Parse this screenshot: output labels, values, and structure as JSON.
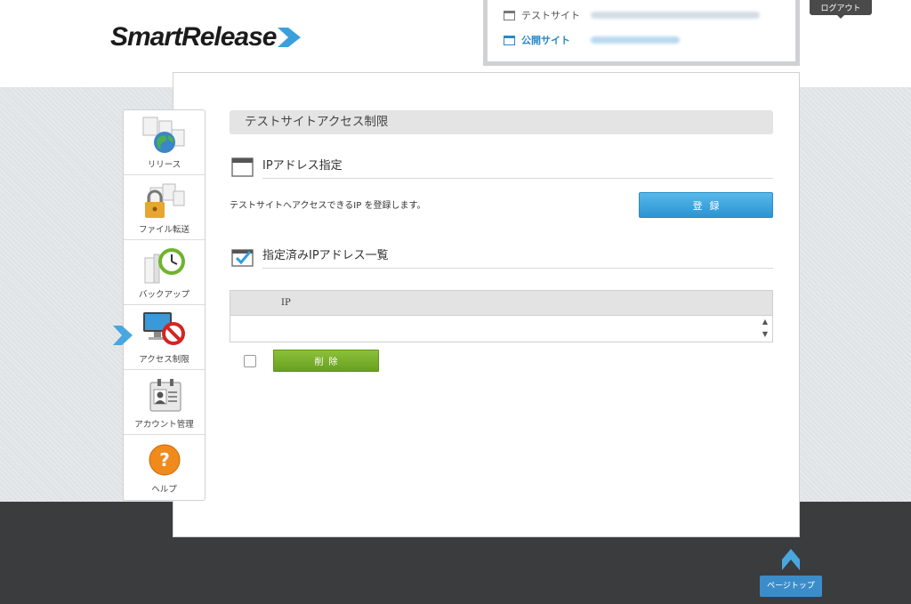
{
  "brand": {
    "name": "SmartRelease"
  },
  "header": {
    "logout_label": "ログアウト",
    "sites": [
      {
        "label": "テストサイト",
        "url": ""
      },
      {
        "label": "公開サイト",
        "url": ""
      }
    ]
  },
  "sidebar": {
    "items": [
      {
        "label": "リリース",
        "icon": "release-globe-icon"
      },
      {
        "label": "ファイル転送",
        "icon": "file-lock-icon"
      },
      {
        "label": "バックアップ",
        "icon": "backup-clock-icon"
      },
      {
        "label": "アクセス制限",
        "icon": "access-restrict-icon",
        "active": true
      },
      {
        "label": "アカウント管理",
        "icon": "account-id-icon"
      },
      {
        "label": "ヘルプ",
        "icon": "help-icon"
      }
    ]
  },
  "main": {
    "page_title": "テストサイトアクセス制限",
    "ip_section": {
      "title": "IPアドレス指定",
      "description": "テストサイトへアクセスできるIP を登録します。",
      "register_label": "登録"
    },
    "list_section": {
      "title": "指定済みIPアドレス一覧",
      "column_header": "IP",
      "delete_label": "削除"
    }
  },
  "footer": {
    "pagetop_label": "ページトップ"
  },
  "colors": {
    "accent_blue": "#2b94d2",
    "accent_green": "#68a021",
    "footer_dark": "#3b3c3e"
  }
}
